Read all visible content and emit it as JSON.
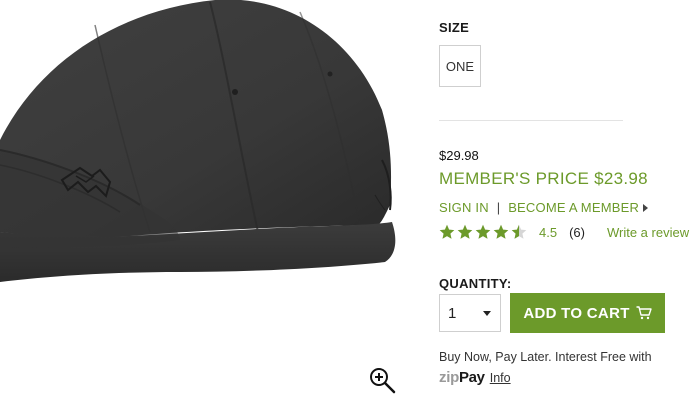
{
  "product": {
    "image_alt": "Black baseball cap with embroidered logo"
  },
  "size": {
    "label": "SIZE",
    "options": [
      "ONE"
    ]
  },
  "pricing": {
    "regular_price": "$29.98",
    "member_price": "MEMBER'S PRICE $23.98"
  },
  "member_links": {
    "sign_in": "SIGN IN",
    "separator": "|",
    "become_member": "BECOME A MEMBER"
  },
  "rating": {
    "value": "4.5",
    "fraction": 0.9,
    "count": "(6)",
    "write_review": "Write a review"
  },
  "quantity": {
    "label": "QUANTITY:",
    "selected": "1"
  },
  "add_to_cart": {
    "label": "ADD TO CART"
  },
  "pay_later": {
    "text": "Buy Now, Pay Later. Interest Free with",
    "brand_zip": "zip",
    "brand_pay": "Pay",
    "info_link": "Info"
  },
  "colors": {
    "accent": "#6c9a2a",
    "cap": "#3a3a3a"
  },
  "icons": {
    "zoom": "zoom-in-icon",
    "cart": "cart-icon",
    "star": "star-icon"
  }
}
